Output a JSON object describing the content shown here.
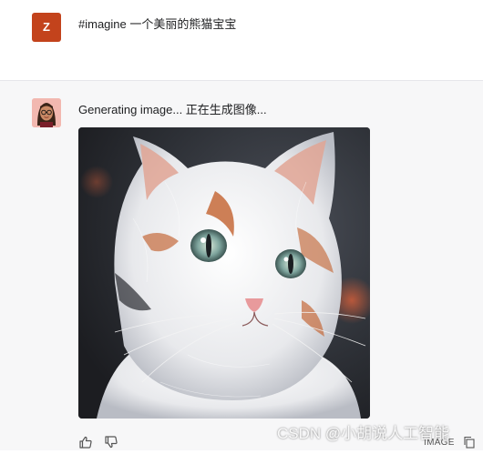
{
  "user_message": {
    "avatar_letter": "Z",
    "text": "#imagine 一个美丽的熊猫宝宝"
  },
  "bot_message": {
    "avatar_icon": "girl-avatar-icon",
    "text": "Generating image... 正在生成图像...",
    "image_subject": "white-and-orange-cat",
    "actions": {
      "thumbs_up_icon": "thumbs-up-icon",
      "thumbs_down_icon": "thumbs-down-icon",
      "image_label": "IMAGE",
      "copy_icon": "copy-icon"
    }
  },
  "watermark": "CSDN @小胡说人工智能",
  "colors": {
    "user_avatar_bg": "#c3431c",
    "bot_block_bg": "#f7f7f8",
    "bot_avatar_bg": "#f2b8b0"
  }
}
